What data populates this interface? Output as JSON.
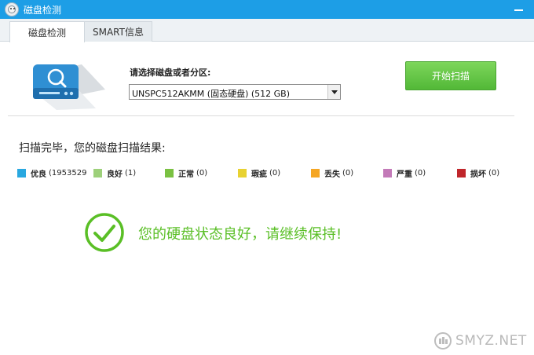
{
  "window": {
    "title": "磁盘检测",
    "accent_color": "#1d9ee6"
  },
  "tabs": [
    {
      "label": "磁盘检测",
      "active": true
    },
    {
      "label": "SMART信息",
      "active": false
    }
  ],
  "disk_selector": {
    "label": "请选择磁盘或者分区:",
    "selected": "UNSPC512AKMM (固态硬盘)  (512 GB)"
  },
  "scan_button": {
    "label": "开始扫描",
    "color": "#5abf3a"
  },
  "results": {
    "heading": "扫描完毕，您的磁盘扫描结果:",
    "legend": [
      {
        "name": "优良",
        "count": "(1953529",
        "color": "#29a8e0"
      },
      {
        "name": "良好",
        "count": "(1)",
        "color": "#9dd07a"
      },
      {
        "name": "正常",
        "count": "(0)",
        "color": "#7ac142"
      },
      {
        "name": "瑕疵",
        "count": "(0)",
        "color": "#e8d232"
      },
      {
        "name": "丢失",
        "count": "(0)",
        "color": "#f5a623"
      },
      {
        "name": "严重",
        "count": "(0)",
        "color": "#c37ab8"
      },
      {
        "name": "损坏",
        "count": "(0)",
        "color": "#c0262b"
      }
    ],
    "status_icon": "checkmark-circle-icon",
    "status_message": "您的硬盘状态良好，请继续保持!",
    "status_color": "#5abf26"
  },
  "watermark": {
    "text": "SMYZ.NET",
    "logo": "smyz-logo-icon"
  }
}
